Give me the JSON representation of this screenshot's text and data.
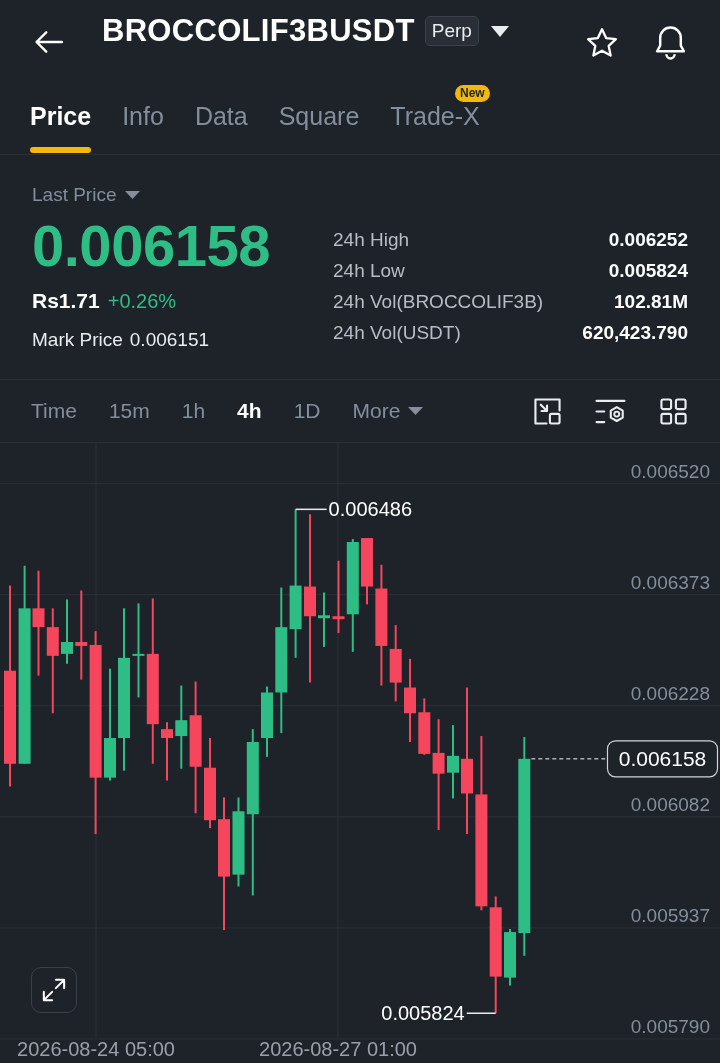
{
  "header": {
    "title": "BROCCOLIF3BUSDT",
    "tag": "Perp"
  },
  "tabs": [
    {
      "label": "Price",
      "selected": true
    },
    {
      "label": "Info",
      "selected": false
    },
    {
      "label": "Data",
      "selected": false
    },
    {
      "label": "Square",
      "selected": false
    },
    {
      "label": "Trade-X",
      "selected": false,
      "badge": "New"
    }
  ],
  "price_panel": {
    "last_price_label": "Last Price",
    "last_price": "0.006158",
    "fiat_price": "Rs1.71",
    "change": "+0.26%",
    "mark_price_label": "Mark Price",
    "mark_price": "0.006151",
    "stats": [
      {
        "label": "24h High",
        "value": "0.006252"
      },
      {
        "label": "24h Low",
        "value": "0.005824"
      },
      {
        "label": "24h Vol(BROCCOLIF3B)",
        "value": "102.81M"
      },
      {
        "label": "24h Vol(USDT)",
        "value": "620,423.790"
      }
    ]
  },
  "intervals": [
    {
      "kind": "interval",
      "label": "Time",
      "selected": false
    },
    {
      "kind": "interval",
      "label": "15m",
      "selected": false
    },
    {
      "kind": "interval",
      "label": "1h",
      "selected": false
    },
    {
      "kind": "interval",
      "label": "4h",
      "selected": true
    },
    {
      "kind": "interval",
      "label": "1D",
      "selected": false
    },
    {
      "kind": "menu",
      "label": "More",
      "selected": false
    }
  ],
  "chart": {
    "y_axis_labels": [
      "0.006520",
      "0.006373",
      "0.006228",
      "0.006082",
      "0.005937",
      "0.005790"
    ],
    "x_axis_labels": [
      "2026-08-24 05:00",
      "2026-08-27 01:00"
    ],
    "high_label": "0.006486",
    "low_label": "0.005824",
    "last_price_tag": "0.006158"
  }
}
